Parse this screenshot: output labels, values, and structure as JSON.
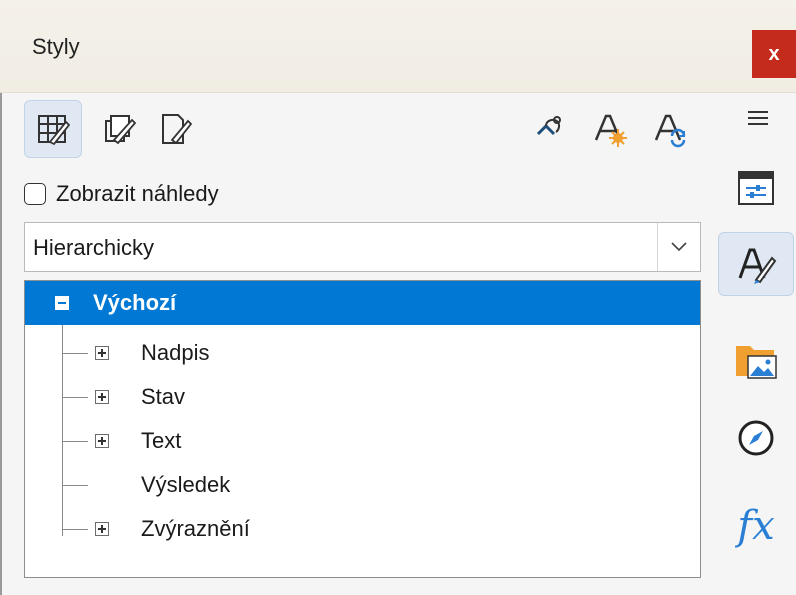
{
  "window": {
    "title": "Styly",
    "close_label": "x"
  },
  "toolbar": {
    "left_icons": [
      "table-styles-icon",
      "paragraph-styles-icon",
      "page-styles-icon"
    ],
    "right_icons": [
      "fill-format-icon",
      "new-style-icon",
      "update-style-icon"
    ]
  },
  "preview": {
    "label": "Zobrazit náhledy",
    "checked": false
  },
  "filter": {
    "selected": "Hierarchicky"
  },
  "tree": {
    "root": {
      "label": "Výchozí",
      "expanded": true
    },
    "children": [
      {
        "label": "Nadpis",
        "expandable": true
      },
      {
        "label": "Stav",
        "expandable": true
      },
      {
        "label": "Text",
        "expandable": true
      },
      {
        "label": "Výsledek",
        "expandable": false
      },
      {
        "label": "Zvýraznění",
        "expandable": true
      }
    ]
  },
  "sidebar": {
    "menu_icon": "hamburger-icon",
    "items": [
      "properties-icon",
      "styles-icon",
      "gallery-icon",
      "navigator-icon",
      "functions-icon"
    ],
    "functions_label": "fx",
    "active": "styles-icon"
  },
  "colors": {
    "selection": "#0078d4",
    "close": "#c42b1c",
    "accent": "#2a7fd4",
    "orange": "#f0a030"
  }
}
